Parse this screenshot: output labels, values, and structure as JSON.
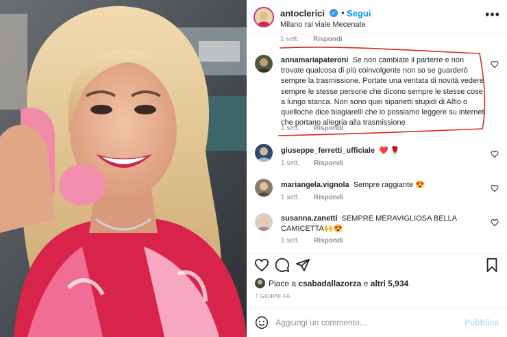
{
  "post": {
    "username": "antoclerici",
    "follow_label": "Segui",
    "dot": "•",
    "location": "Milano rai viale Mecenate",
    "more_icon": "more-options-icon",
    "verified_icon": "verified-badge-icon"
  },
  "previous_comment_meta": {
    "time": "1 sett.",
    "reply": "Rispondi"
  },
  "comments": [
    {
      "user": "annamariapateroni",
      "text": "Se non cambiate il parterre e non trovate qualcosa di più coinvolgente non so se guarderò sempre la trasmissione. Portate una ventata di novità vedere sempre le stesse persone che dicono sempre le stesse cose a lungo stanca. Non sono quei siparietti stupidi di Alfio o quelloche dice biagiarelli che lo possiamo leggere su internet che portano allegria alla trasmissione",
      "time": "1 sett.",
      "reply": "Rispondi"
    },
    {
      "user": "giuseppe_ferretti_ufficiale",
      "text": "",
      "emoji": "❤️ 🌹",
      "time": "1 sett.",
      "reply": "Rispondi"
    },
    {
      "user": "mariangela.vignola",
      "text": "Sempre raggiante",
      "emoji": "😍",
      "time": "1 sett.",
      "reply": "Rispondi"
    },
    {
      "user": "susanna.zanetti",
      "text": "SEMPRE MERAVIGLIOSA BELLA CAMICETTA",
      "emoji": "🙌😍",
      "time": "1 sett.",
      "reply": "Rispondi"
    }
  ],
  "actions": {
    "like_icon": "heart-outline-icon",
    "comment_icon": "comment-bubble-icon",
    "share_icon": "paper-plane-icon",
    "save_icon": "bookmark-icon"
  },
  "likes": {
    "prefix": "Piace a",
    "user": "csabadallazorza",
    "joiner": "e",
    "count": "altri 5,934"
  },
  "date": "7 GIORNI FA",
  "add_comment": {
    "placeholder": "Aggiungi un commento...",
    "publish_label": "Pubblica",
    "emoji_icon": "smiley-icon"
  },
  "colors": {
    "accent": "#0095f6",
    "publish_disabled": "#b2dffc",
    "secondary_text": "#8e8e8e",
    "annotation_red": "#e0261c"
  }
}
